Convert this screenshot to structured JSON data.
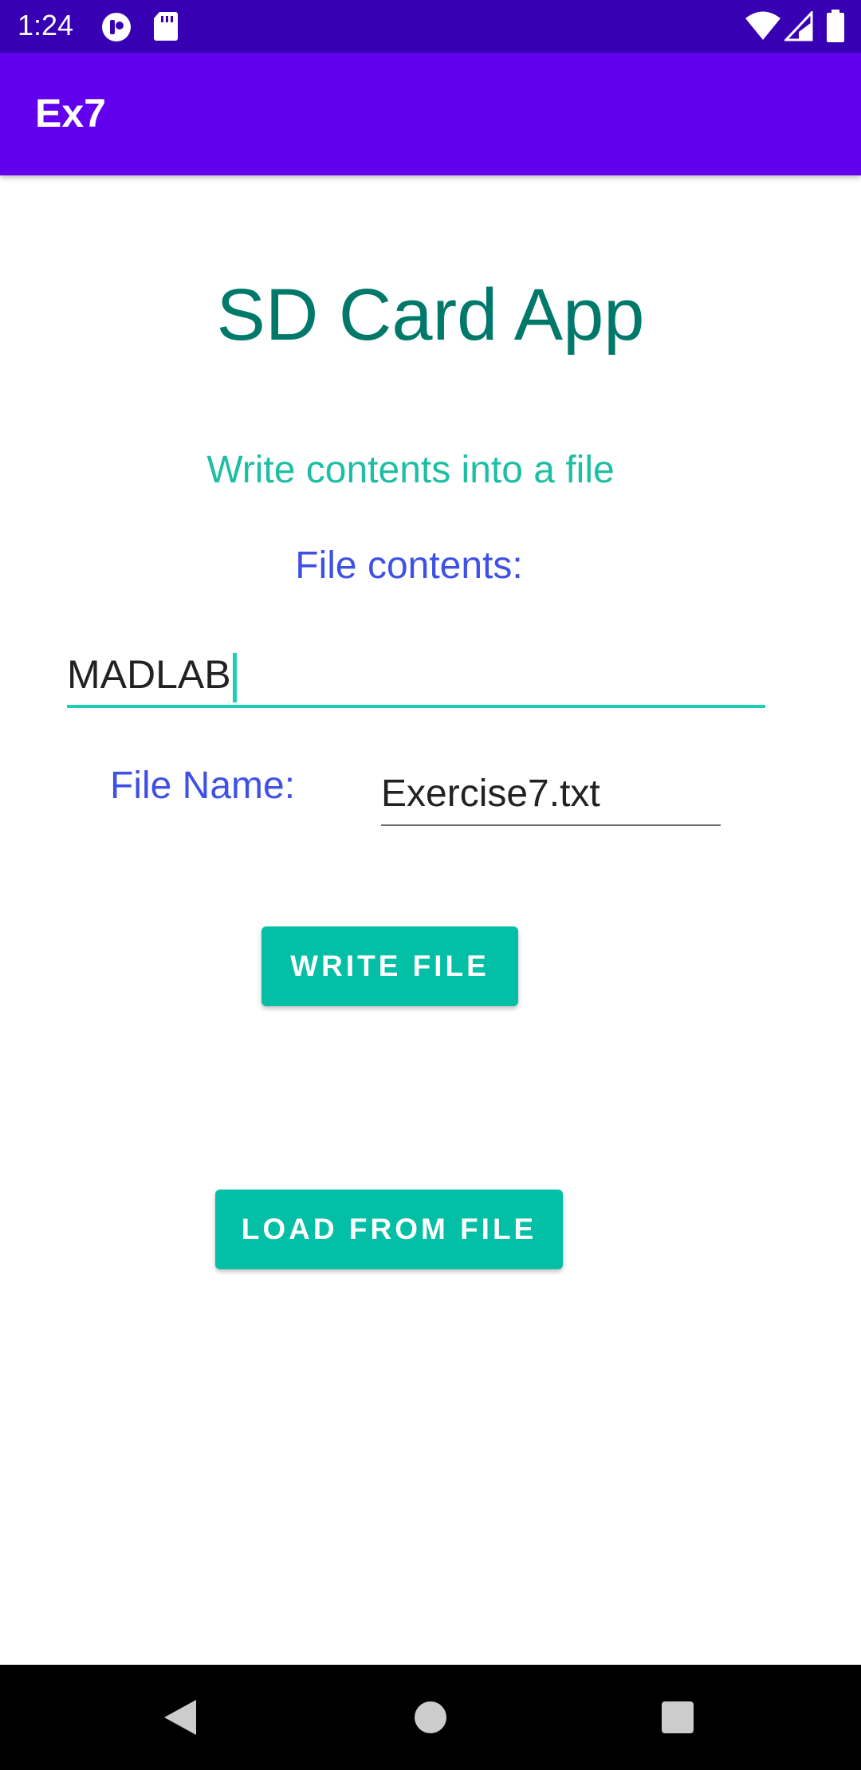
{
  "status_bar": {
    "time": "1:24",
    "icons": [
      "notification-app-icon",
      "sd-card-icon",
      "wifi-icon",
      "signal-icon",
      "battery-icon"
    ]
  },
  "app_bar": {
    "title": "Ex7"
  },
  "main": {
    "heading": "SD Card App",
    "subheading": "Write contents into a file",
    "contents_label": "File contents:",
    "contents_value": "MADLAB",
    "file_name_label": "File Name:",
    "file_name_value": "Exercise7.txt",
    "write_button_label": "WRITE FILE",
    "load_button_label": "LOAD FROM FILE"
  },
  "nav_bar": {
    "icons": [
      "back-icon",
      "home-icon",
      "recents-icon"
    ]
  },
  "colors": {
    "status_bar": "#3700B3",
    "app_bar": "#6200EE",
    "heading": "#00796B",
    "subheading": "#1DBFA3",
    "label": "#3F51E5",
    "button": "#03BFA5",
    "field_focus": "#1DCDB4"
  }
}
